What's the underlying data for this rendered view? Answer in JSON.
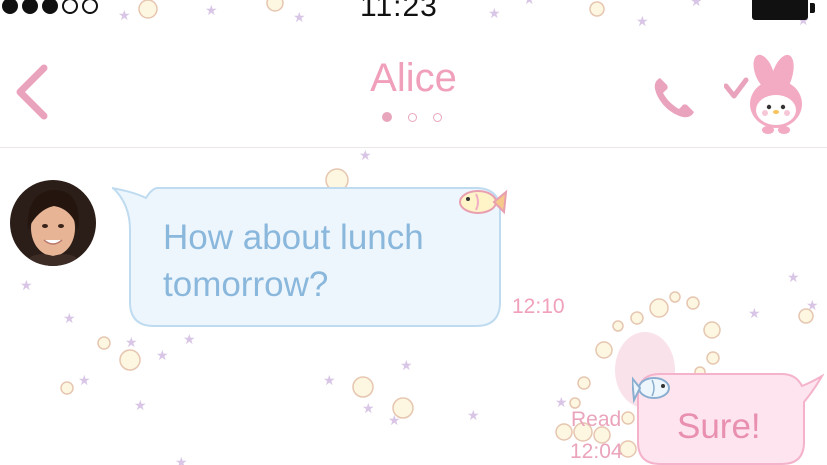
{
  "status_bar": {
    "signal_dots": [
      true,
      true,
      true,
      false,
      false
    ],
    "time": "11:23"
  },
  "header": {
    "title": "Alice",
    "back_icon": "chevron-left-icon",
    "call_icon": "phone-icon",
    "mascot_icon": "my-melody-mascot-icon",
    "page_indicator": {
      "total": 3,
      "active": 0
    }
  },
  "conversation": {
    "incoming": {
      "text": "How about lunch tomorrow?",
      "time": "12:10"
    },
    "outgoing": {
      "text": "Sure!",
      "status": "Read",
      "time": "12:04"
    }
  },
  "theme": {
    "accent_pink": "#f0a0ba",
    "incoming_text": "#8ab7dc",
    "incoming_bubble": "#eef6fd",
    "outgoing_bubble": "#fde4ee"
  }
}
